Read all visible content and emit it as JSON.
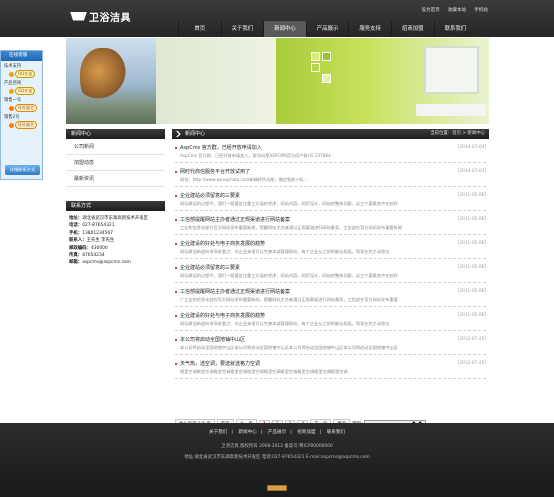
{
  "logo": {
    "text": "卫浴洁具"
  },
  "toplinks": [
    "设为首页",
    "收藏本站",
    "手机站"
  ],
  "nav": [
    "首页",
    "关于我们",
    "新闻中心",
    "产品展示",
    "服务支持",
    "招商加盟",
    "联系我们"
  ],
  "nav_active_index": 2,
  "float_service": {
    "title": "在线客服",
    "rows": [
      {
        "label": "技术支持",
        "kind": "qq",
        "btn": "QQ交谈"
      },
      {
        "label": "产品咨询",
        "kind": "qq",
        "btn": "QQ交谈"
      },
      {
        "label": "销售一号",
        "kind": "ww",
        "btn": "旺旺留言"
      },
      {
        "label": "销售2号",
        "kind": "ww",
        "btn": "旺旺留言"
      }
    ],
    "footer": "详细联系方式"
  },
  "left_menu": {
    "title": "新闻中心",
    "items": [
      "公司新闻",
      "加盟动态",
      "最新资讯"
    ]
  },
  "contact": {
    "title": "联系方式",
    "lines": [
      {
        "k": "地址：",
        "v": "湖北省武汉市东湖高新技术开发区"
      },
      {
        "k": "电话：",
        "v": "027-87654321"
      },
      {
        "k": "手机：",
        "v": "13801234567"
      },
      {
        "k": "联系人：",
        "v": "王先生 李先生"
      },
      {
        "k": "邮政编码：",
        "v": "430000"
      },
      {
        "k": "传真：",
        "v": "87654234"
      },
      {
        "k": "邮箱：",
        "v": "aspcms@aspcms.com"
      }
    ]
  },
  "main": {
    "title": "新闻中心",
    "breadcrumb": "当前位置：首页 > 新闻中心",
    "news": [
      {
        "title": "AspCms 官方群，已经开放申请加入",
        "date": "[2014-07-04]",
        "summary": "AspCms 官方群，已经开放申请加入，群号码是ASPCMS官方用户群(4) 237804"
      },
      {
        "title": "网时代商信服务平台开放试用了",
        "date": "[2014-07-03]",
        "summary": "网址：http://www.wangshida.com新精特色功能：微信智能>科..."
      },
      {
        "title": "企业建站必须留意的三要素",
        "date": "[2011-05-06]",
        "summary": "网站建设的过程中，我们一般要会注重三方面的考虑：网站内容，网页设计，网站的整体功能。这三个要素其中在制作"
      },
      {
        "title": "工信部提醒网站主办者通过正规渠道进行网站备案",
        "date": "[2011-05-06]",
        "summary": "工业和信息化部在官方网站发布重要新闻，提醒网站主办者通过正规渠道进行网站备案，工信部在官方网站发布重要新闻"
      },
      {
        "title": "企业建设的好处与电子商务发展的趋势",
        "date": "[2011-05-06]",
        "summary": "网站建设新趋向市场各要点：对企业来说可以完善本部管理网站，每个企业从之前的被动局面，到现在的主动地位"
      },
      {
        "title": "企业建站必须留意的三要素",
        "date": "[2011-05-06]",
        "summary": "网站建设的过程中，我们一般要会注重三方面的考虑：网站内容，网页设计，网站的整体功能。这三个要素其中在制作"
      },
      {
        "title": "工信部提醒网站主办者通过正规渠道进行网站备案",
        "date": "[2011-05-06]",
        "summary": "广工业和信息化部在官方网站发布重要新闻，提醒网站主办者通过正规渠道进行网站备案，工信部在官方网站发布重要"
      },
      {
        "title": "企业建设的好处与电子商务发展的趋势",
        "date": "[2011-05-06]",
        "summary": "网站建设新趋向市场各要点：对企业来说可以完善本部管理网站，每个企业从之前的被动局面，到现在的主动地位"
      },
      {
        "title": "本公司将启动全国地铺中山区",
        "date": "[2012-07-25]",
        "summary": "本公司将启动全国地铺中山区本公司将启动全国地铺中山区本公司将启动全国地铺中山区本公司将启动全国地铺中山区"
      },
      {
        "title": "天气热，选空调，要选就选格力空调",
        "date": "[2012-07-25]",
        "summary": "格里空调格里空调格里空调格里空调格里空调格里空调格里空调格里空调格里空调格里空调"
      }
    ]
  },
  "pager": {
    "info": "共4 页次:1/4 页",
    "first": "首页",
    "prev": "上一页",
    "pages": [
      "1",
      "2",
      "3",
      "4"
    ],
    "current": "1",
    "next": "下一页",
    "last": "尾页",
    "jump": "转到:",
    "select_value": "1"
  },
  "footer": {
    "links": [
      "关于我们",
      "新闻中心",
      "产品展示",
      "招商加盟",
      "联系我们"
    ],
    "copyright": "卫浴洁具 版权所有 2008-2012   备案号:粤ICP00000000",
    "address": "地址:湖北省武汉市东湖高新技术开发区 电话:027-87654321 E-mail:aspcms@aspcms.com"
  }
}
